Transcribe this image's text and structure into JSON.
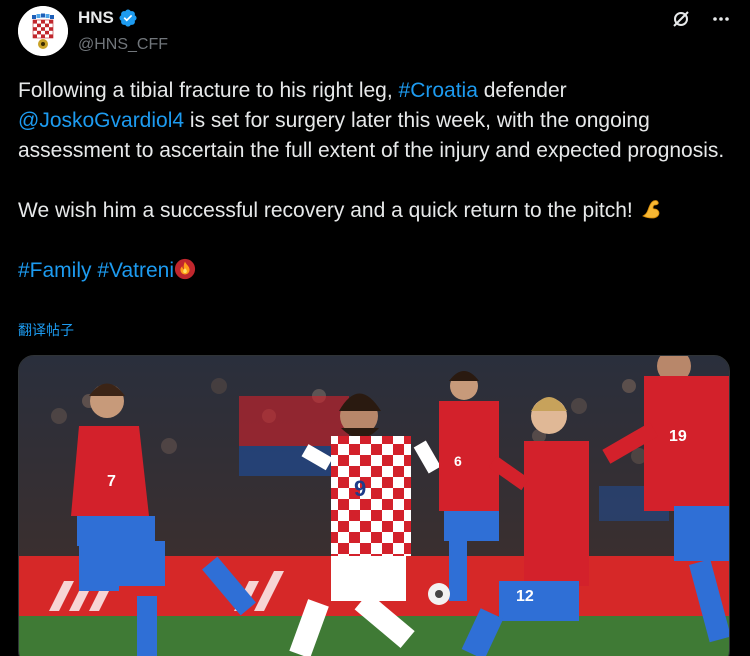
{
  "author": {
    "display_name": "HNS",
    "handle": "@HNS_CFF",
    "verified": true,
    "avatar_icon": "hns-crest-icon"
  },
  "actions": {
    "grok_icon": "grok-icon",
    "more_icon": "more-icon"
  },
  "tweet": {
    "line1_pre": "Following a tibial fracture to his right leg, ",
    "hashtag_croatia": "#Croatia",
    "line1_post": " defender",
    "mention": "@JoskoGvardiol4",
    "line2_post": " is set for surgery later this week, with the ongoing assessment to ascertain the full extent of the injury and expected prognosis.",
    "line3": "We wish him a successful recovery and a quick return to the pitch! ",
    "hashtag_family": "#Family",
    "hashtag_vatreni": "#Vatreni",
    "translate_label": "翻译帖子"
  },
  "media": {
    "players": [
      {
        "team": "croatia",
        "number": "9"
      },
      {
        "team": "czech",
        "number": "7"
      },
      {
        "team": "czech",
        "number": "6"
      },
      {
        "team": "czech",
        "number": "12"
      },
      {
        "team": "czech",
        "number": "19"
      }
    ]
  },
  "colors": {
    "background": "#000000",
    "text": "#e7e9ea",
    "secondary": "#71767b",
    "link": "#1d9bf0",
    "verified": "#1d9bf0"
  }
}
